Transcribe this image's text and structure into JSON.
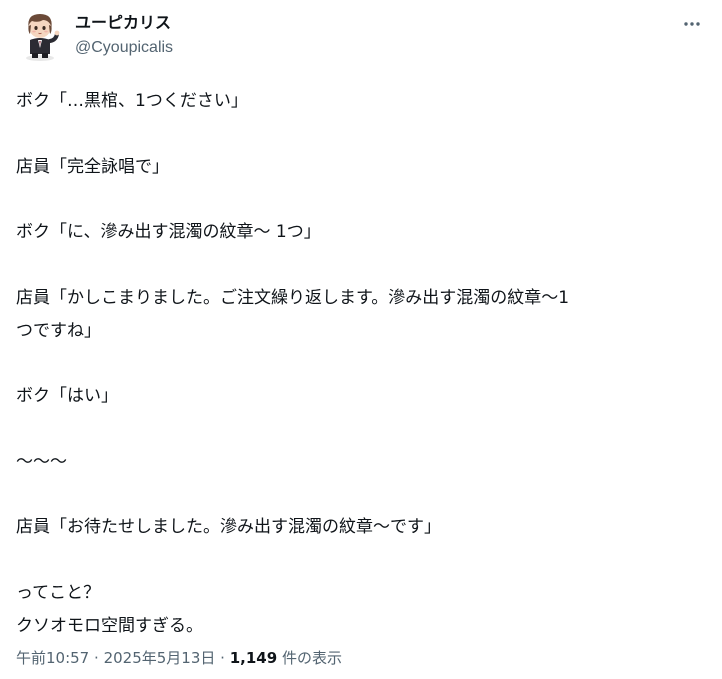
{
  "author": {
    "display_name": "ユーピカリス",
    "handle": "@Cyoupicalis"
  },
  "menu_icon": "more-dots-icon",
  "body_lines": [
    "ボク「…黒棺、1つください」",
    "",
    "店員「完全詠唱で」",
    "",
    "ボク「に、滲み出す混濁の紋章～ 1つ」",
    "",
    "店員「かしこまりました。ご注文繰り返します。滲み出す混濁の紋章～1",
    "つですね」",
    "",
    "ボク「はい」",
    "",
    "～～～",
    "",
    "店員「お待たせしました。滲み出す混濁の紋章～です」",
    "",
    "ってこと？",
    "クソオモロ空間すぎる。"
  ],
  "meta": {
    "time": "午前10:57",
    "separator": "·",
    "date": "2025年5月13日",
    "views_count": "1,149",
    "views_label": "件の表示"
  },
  "colors": {
    "text": "#0f1419",
    "secondary": "#536471"
  }
}
